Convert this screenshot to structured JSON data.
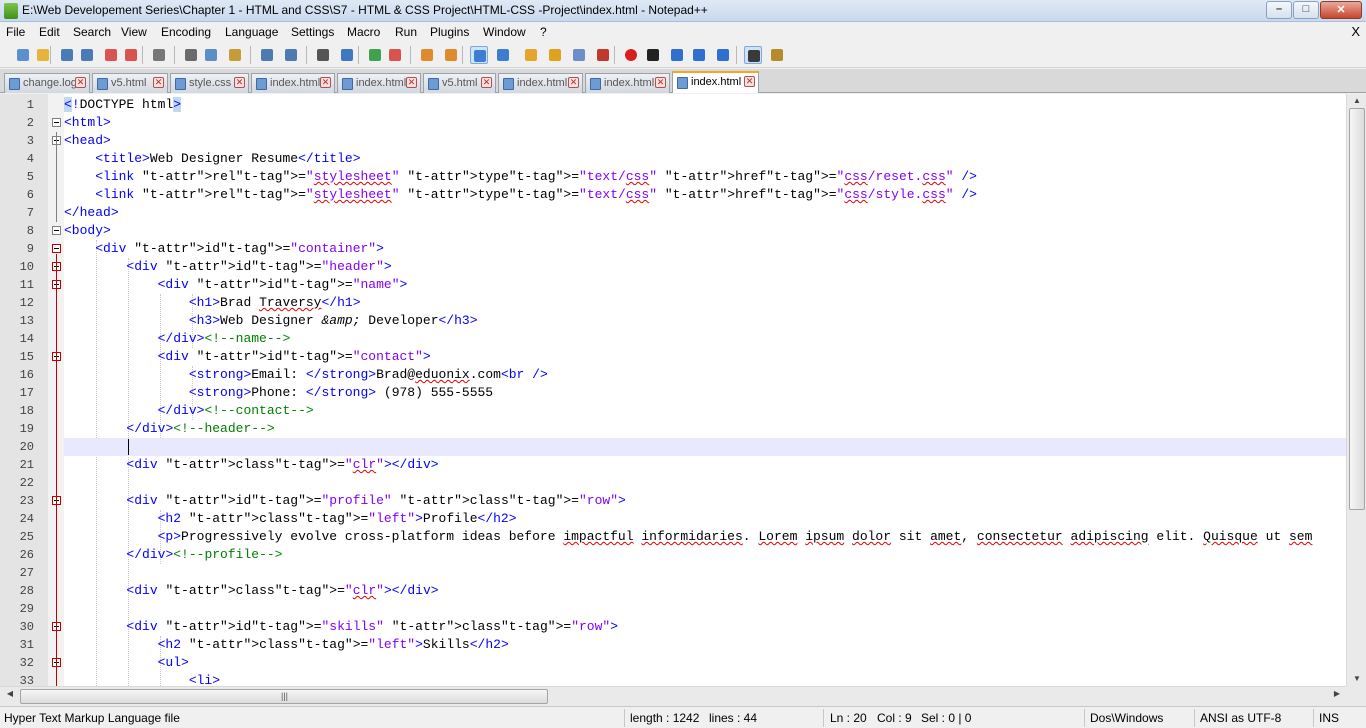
{
  "window": {
    "title": "E:\\Web Developement Series\\Chapter 1 - HTML and CSS\\S7 - HTML & CSS Project\\HTML-CSS -Project\\index.html - Notepad++",
    "minimize_glyph": "–",
    "maximize_glyph": "□",
    "close_glyph": "✕"
  },
  "menu": {
    "items": [
      "File",
      "Edit",
      "Search",
      "View",
      "Encoding",
      "Language",
      "Settings",
      "Macro",
      "Run",
      "Plugins",
      "Window",
      "?"
    ],
    "close_glyph": "X"
  },
  "toolbar": {
    "icons": [
      "new-file-icon",
      "open-file-icon",
      "save-icon",
      "save-all-icon",
      "close-icon",
      "close-all-icon",
      "print-icon",
      "cut-icon",
      "copy-icon",
      "paste-icon",
      "undo-icon",
      "redo-icon",
      "find-icon",
      "replace-icon",
      "zoom-in-icon",
      "zoom-out-icon",
      "sync-vertical-icon",
      "sync-horizontal-icon",
      "word-wrap-icon",
      "show-all-chars-icon",
      "indent-guide-icon",
      "user-language-icon",
      "doc-map-icon",
      "function-list-icon",
      "record-macro-icon",
      "stop-macro-icon",
      "play-macro-icon",
      "run-macro-multiple-icon",
      "save-macro-icon",
      "spell-check-icon",
      "plugin-icon"
    ]
  },
  "tabs": [
    {
      "label": "change.log",
      "active": false
    },
    {
      "label": "v5.html",
      "active": false
    },
    {
      "label": "style.css",
      "active": false
    },
    {
      "label": "index.html",
      "active": false
    },
    {
      "label": "index.html",
      "active": false
    },
    {
      "label": "v5.html",
      "active": false
    },
    {
      "label": "index.html",
      "active": false
    },
    {
      "label": "index.html",
      "active": false
    },
    {
      "label": "index.html",
      "active": true
    }
  ],
  "tab_close_glyph": "✕",
  "editor": {
    "current_line": 20,
    "lines": [
      {
        "n": 1,
        "text": "<!DOCTYPE html>"
      },
      {
        "n": 2,
        "text": "<html>"
      },
      {
        "n": 3,
        "text": "<head>"
      },
      {
        "n": 4,
        "text": "    <title>Web Designer Resume</title>"
      },
      {
        "n": 5,
        "text": "    <link rel=\"stylesheet\" type=\"text/css\" href=\"css/reset.css\" />"
      },
      {
        "n": 6,
        "text": "    <link rel=\"stylesheet\" type=\"text/css\" href=\"css/style.css\" />"
      },
      {
        "n": 7,
        "text": "</head>"
      },
      {
        "n": 8,
        "text": "<body>"
      },
      {
        "n": 9,
        "text": "    <div id=\"container\">"
      },
      {
        "n": 10,
        "text": "        <div id=\"header\">"
      },
      {
        "n": 11,
        "text": "            <div id=\"name\">"
      },
      {
        "n": 12,
        "text": "                <h1>Brad Traversy</h1>"
      },
      {
        "n": 13,
        "text": "                <h3>Web Designer &amp; Developer</h3>"
      },
      {
        "n": 14,
        "text": "            </div><!--name-->"
      },
      {
        "n": 15,
        "text": "            <div id=\"contact\">"
      },
      {
        "n": 16,
        "text": "                <strong>Email: </strong>Brad@eduonix.com<br />"
      },
      {
        "n": 17,
        "text": "                <strong>Phone: </strong> (978) 555-5555"
      },
      {
        "n": 18,
        "text": "            </div><!--contact-->"
      },
      {
        "n": 19,
        "text": "        </div><!--header-->"
      },
      {
        "n": 20,
        "text": "        "
      },
      {
        "n": 21,
        "text": "        <div class=\"clr\"></div>"
      },
      {
        "n": 22,
        "text": ""
      },
      {
        "n": 23,
        "text": "        <div id=\"profile\" class=\"row\">"
      },
      {
        "n": 24,
        "text": "            <h2 class=\"left\">Profile</h2>"
      },
      {
        "n": 25,
        "text": "            <p>Progressively evolve cross-platform ideas before impactful informidaries. Lorem ipsum dolor sit amet, consectetur adipiscing elit. Quisque ut sem"
      },
      {
        "n": 26,
        "text": "        </div><!--profile-->"
      },
      {
        "n": 27,
        "text": ""
      },
      {
        "n": 28,
        "text": "        <div class=\"clr\"></div>"
      },
      {
        "n": 29,
        "text": ""
      },
      {
        "n": 30,
        "text": "        <div id=\"skills\" class=\"row\">"
      },
      {
        "n": 31,
        "text": "            <h2 class=\"left\">Skills</h2>"
      },
      {
        "n": 32,
        "text": "            <ul>"
      },
      {
        "n": 33,
        "text": "                <li>"
      }
    ],
    "fold_points": [
      2,
      3,
      8,
      9,
      10,
      11,
      15,
      23,
      30,
      32
    ],
    "fold_ends": [
      7
    ]
  },
  "scrollbars": {
    "up_glyph": "▲",
    "down_glyph": "▼",
    "left_glyph": "◀",
    "right_glyph": "▶",
    "grip_glyph": "|||"
  },
  "status": {
    "language": "Hyper Text Markup Language file",
    "length": "length : 1242",
    "lines": "lines : 44",
    "ln": "Ln : 20",
    "col": "Col : 9",
    "sel": "Sel : 0 | 0",
    "eol": "Dos\\Windows",
    "encoding": "ANSI as UTF-8",
    "mode": "INS"
  },
  "colors": {
    "tag": "#0000ff",
    "attribute": "#ff0000",
    "value": "#8000ff",
    "comment": "#008000",
    "current_line": "#e8e8ff",
    "active_tab_accent": "#f5a623"
  }
}
